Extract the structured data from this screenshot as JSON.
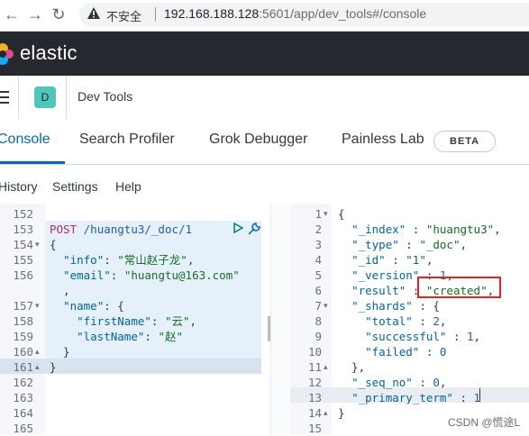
{
  "browser": {
    "back": "←",
    "forward": "→",
    "reload": "↻",
    "insecure_label": "不安全",
    "url_host": "192.168.188.128",
    "url_rest": ":5601/app/dev_tools#/console"
  },
  "header": {
    "brand": "elastic"
  },
  "appbar": {
    "space_initial": "D",
    "breadcrumb": "Dev Tools"
  },
  "tabs": [
    {
      "label": "Console",
      "active": true
    },
    {
      "label": "Search Profiler"
    },
    {
      "label": "Grok Debugger"
    },
    {
      "label": "Painless Lab"
    }
  ],
  "beta_badge": "BETA",
  "toolbar": {
    "history": "History",
    "settings": "Settings",
    "help": "Help"
  },
  "request": {
    "lines": [
      {
        "n": "152",
        "code": ""
      },
      {
        "n": "153",
        "code": "POST /huangtu3/_doc/1"
      },
      {
        "n": "154",
        "code": "{",
        "fold": "▾"
      },
      {
        "n": "155",
        "code": "  \"info\": \"常山赵子龙\","
      },
      {
        "n": "156",
        "code": "  \"email\": \"huangtu@163.com\""
      },
      {
        "n": "",
        "code": "  ,"
      },
      {
        "n": "157",
        "code": "  \"name\": {",
        "fold": "▾"
      },
      {
        "n": "158",
        "code": "    \"firstName\": \"云\","
      },
      {
        "n": "159",
        "code": "    \"lastName\": \"赵\""
      },
      {
        "n": "160",
        "code": "  }",
        "fold": "▴"
      },
      {
        "n": "161",
        "code": "}",
        "fold": "▴"
      },
      {
        "n": "162",
        "code": ""
      },
      {
        "n": "163",
        "code": ""
      },
      {
        "n": "164",
        "code": ""
      },
      {
        "n": "165",
        "code": ""
      }
    ]
  },
  "response": {
    "lines": [
      {
        "n": "1",
        "code": "{",
        "fold": "▾"
      },
      {
        "n": "2",
        "code": "  \"_index\" : \"huangtu3\","
      },
      {
        "n": "3",
        "code": "  \"_type\" : \"_doc\","
      },
      {
        "n": "4",
        "code": "  \"_id\" : \"1\","
      },
      {
        "n": "5",
        "code": "  \"_version\" : 1,"
      },
      {
        "n": "6",
        "code": "  \"result\" : \"created\","
      },
      {
        "n": "7",
        "code": "  \"_shards\" : {",
        "fold": "▾"
      },
      {
        "n": "8",
        "code": "    \"total\" : 2,"
      },
      {
        "n": "9",
        "code": "    \"successful\" : 1,"
      },
      {
        "n": "10",
        "code": "    \"failed\" : 0"
      },
      {
        "n": "11",
        "code": "  },",
        "fold": "▴"
      },
      {
        "n": "12",
        "code": "  \"_seq_no\" : 0,"
      },
      {
        "n": "13",
        "code": "  \"_primary_term\" : 1"
      },
      {
        "n": "14",
        "code": "}",
        "fold": "▴"
      },
      {
        "n": "15",
        "code": ""
      }
    ]
  },
  "watermark": "CSDN @慌途L",
  "colors": {
    "accent": "#006bb4",
    "header_bg": "#25282f",
    "highlight": "#e3241c"
  }
}
